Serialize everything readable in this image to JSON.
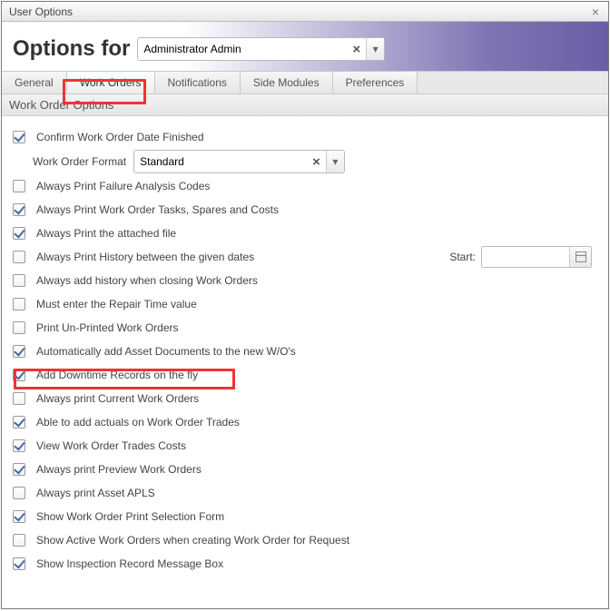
{
  "window": {
    "title": "User Options"
  },
  "header": {
    "label": "Options for",
    "user": "Administrator Admin"
  },
  "tabs": [
    {
      "label": "General"
    },
    {
      "label": "Work Orders"
    },
    {
      "label": "Notifications"
    },
    {
      "label": "Side Modules"
    },
    {
      "label": "Preferences"
    }
  ],
  "active_tab": 1,
  "section": {
    "heading": "Work Order Options"
  },
  "wof": {
    "label": "Work Order Format",
    "value": "Standard"
  },
  "start": {
    "label": "Start:",
    "value": ""
  },
  "options": [
    {
      "checked": true,
      "label": "Confirm Work Order Date Finished"
    },
    {
      "checked": false,
      "label": "Always Print Failure Analysis Codes"
    },
    {
      "checked": true,
      "label": "Always Print Work Order Tasks, Spares and Costs"
    },
    {
      "checked": true,
      "label": "Always Print the attached file"
    },
    {
      "checked": false,
      "label": "Always Print History between the given dates"
    },
    {
      "checked": false,
      "label": "Always add history when closing Work Orders"
    },
    {
      "checked": false,
      "label": "Must enter the Repair Time value"
    },
    {
      "checked": false,
      "label": "Print Un-Printed Work Orders"
    },
    {
      "checked": true,
      "label": "Automatically add Asset Documents to the new W/O's"
    },
    {
      "checked": true,
      "label": "Add Downtime Records on the fly"
    },
    {
      "checked": false,
      "label": "Always print Current Work Orders"
    },
    {
      "checked": true,
      "label": "Able to add actuals on Work Order Trades"
    },
    {
      "checked": true,
      "label": "View Work Order Trades Costs"
    },
    {
      "checked": true,
      "label": "Always print Preview Work Orders"
    },
    {
      "checked": false,
      "label": "Always print Asset APLS"
    },
    {
      "checked": true,
      "label": "Show Work Order Print Selection Form"
    },
    {
      "checked": false,
      "label": "Show Active Work Orders when creating Work Order for Request"
    },
    {
      "checked": true,
      "label": "Show Inspection Record Message Box"
    }
  ],
  "highlights": {
    "tab_index": 1,
    "option_index": 9
  }
}
